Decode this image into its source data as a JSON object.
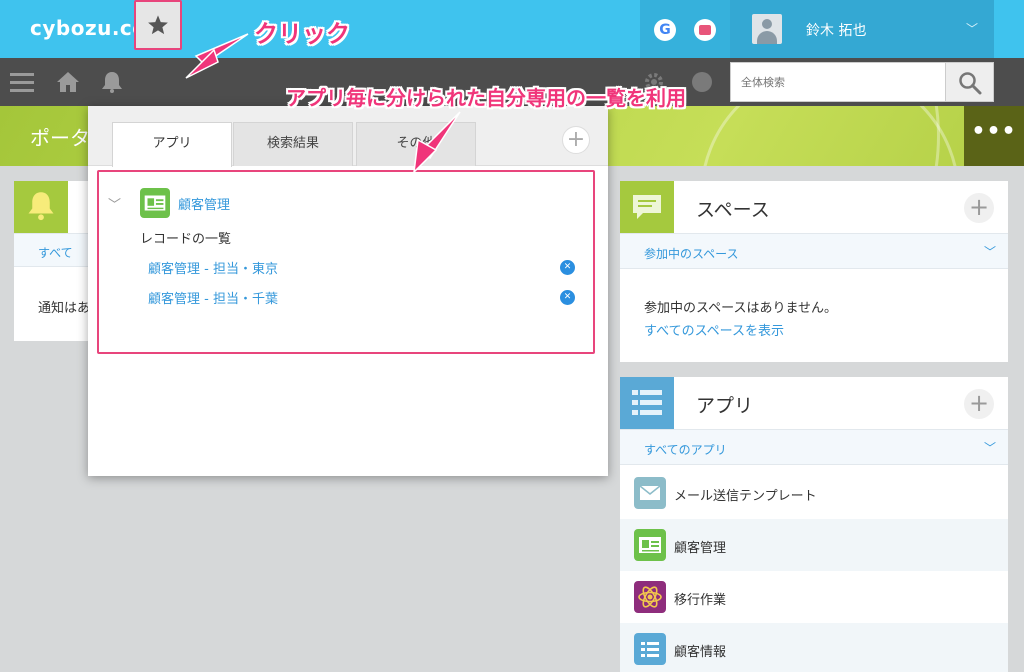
{
  "header": {
    "logo": "cybozu.com",
    "google_label": "G",
    "user_name": "鈴木 拓也",
    "user_chevron": "﹀"
  },
  "toolbar": {
    "menu_icon": "☰",
    "home_icon": "⌂",
    "bell_icon": "🔔",
    "star_icon": "★",
    "search_placeholder": "全体検索"
  },
  "banner": {
    "title": "ポータ",
    "more_label": "•••"
  },
  "notifications": {
    "filter_label": "すべて",
    "message": "通知はあ"
  },
  "popup": {
    "tabs": [
      {
        "label": "アプリ"
      },
      {
        "label": "検索結果"
      },
      {
        "label": "その他"
      }
    ],
    "plus_label": "+",
    "favorites": {
      "chevron": "﹀",
      "app_name": "顧客管理",
      "category": "レコードの一覧",
      "links": [
        {
          "label": "顧客管理 - 担当・東京",
          "remove": "✕"
        },
        {
          "label": "顧客管理 - 担当・千葉",
          "remove": "✕"
        }
      ]
    }
  },
  "spaces_panel": {
    "title": "スペース",
    "plus_label": "+",
    "filter_label": "参加中のスペース",
    "chevron": "﹀",
    "empty_message": "参加中のスペースはありません。",
    "show_all_link": "すべてのスペースを表示"
  },
  "apps_panel": {
    "title": "アプリ",
    "plus_label": "+",
    "filter_label": "すべてのアプリ",
    "chevron": "﹀",
    "items": [
      {
        "name": "メール送信テンプレート"
      },
      {
        "name": "顧客管理"
      },
      {
        "name": "移行作業"
      },
      {
        "name": "顧客情報"
      }
    ]
  },
  "annotations": {
    "click": "クリック",
    "description": "アプリ毎に分けられた自分専用の一覧を利用"
  },
  "colors": {
    "accent": "#3fc3ee",
    "highlight": "#e8457c",
    "link": "#3498db",
    "banner_green": "#b3cf46"
  }
}
